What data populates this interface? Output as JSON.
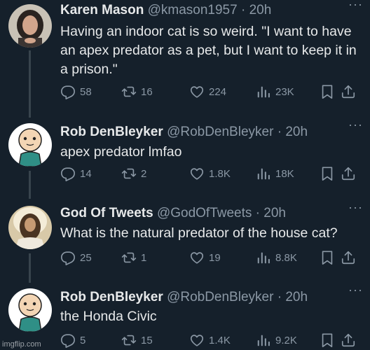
{
  "tweets": [
    {
      "name": "Karen Mason",
      "handle": "@kmason1957",
      "time": "20h",
      "text": "Having an indoor cat is so weird. \"I want to have an apex predator as a pet, but I want to keep it in a prison.\"",
      "replies": "58",
      "retweets": "16",
      "likes": "224",
      "views": "23K"
    },
    {
      "name": "Rob DenBleyker",
      "handle": "@RobDenBleyker",
      "time": "20h",
      "text": "apex predator lmfao",
      "replies": "14",
      "retweets": "2",
      "likes": "1.8K",
      "views": "18K"
    },
    {
      "name": "God Of Tweets",
      "handle": "@GodOfTweets",
      "time": "20h",
      "text": "What is the natural predator of the house cat?",
      "replies": "25",
      "retweets": "1",
      "likes": "19",
      "views": "8.8K"
    },
    {
      "name": "Rob DenBleyker",
      "handle": "@RobDenBleyker",
      "time": "20h",
      "text": "the Honda Civic",
      "replies": "5",
      "retweets": "15",
      "likes": "1.4K",
      "views": "9.2K"
    }
  ],
  "separator": " · ",
  "more_icon": "···",
  "watermark": "imgflip.com",
  "colors": {
    "background": "#15202b",
    "text": "#e7e9ea",
    "muted": "#8b98a5",
    "thread_line": "#38444d"
  }
}
